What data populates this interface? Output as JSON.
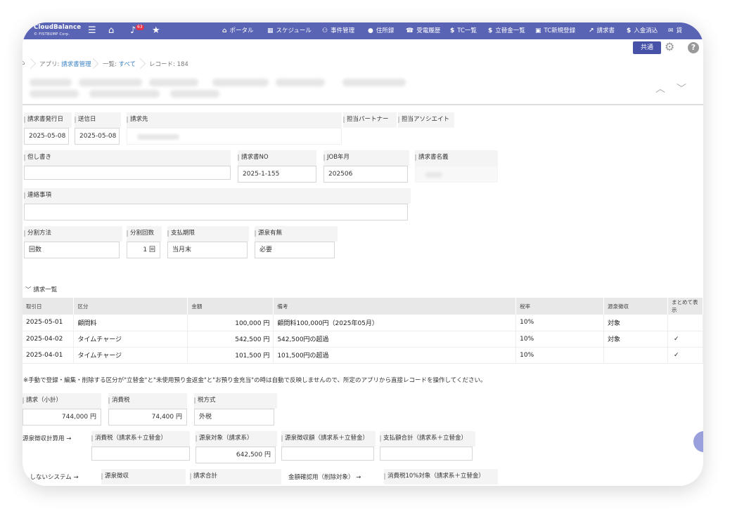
{
  "app": {
    "brand_name": "CloudBalance",
    "brand_sub": "© FISTBUMP Corp.",
    "notification_count": "63"
  },
  "nav": {
    "items": [
      {
        "icon": "⌂",
        "label": "ポータル"
      },
      {
        "icon": "▦",
        "label": "スケジュール"
      },
      {
        "icon": "⚇",
        "label": "事件管理"
      },
      {
        "icon": "●",
        "label": "住所録"
      },
      {
        "icon": "☎",
        "label": "受電履歴"
      },
      {
        "icon": "$",
        "label": "TC一覧"
      },
      {
        "icon": "$",
        "label": "立替金一覧"
      },
      {
        "icon": "▣",
        "label": "TC新規登録"
      },
      {
        "icon": "↗",
        "label": "請求書"
      },
      {
        "icon": "$",
        "label": "入金消込"
      },
      {
        "icon": "✉",
        "label": "貸"
      }
    ]
  },
  "toolbar": {
    "share_label": "共通"
  },
  "breadcrumb": {
    "app_prefix": "アプリ: ",
    "app_name": "請求書管理",
    "list_prefix": "一覧: ",
    "list_name": "すべて",
    "record": "レコード: 184"
  },
  "form": {
    "issue_date_label": "請求書発行日",
    "issue_date": "2025-05-08",
    "send_date_label": "送信日",
    "send_date": "2025-05-08",
    "billing_to_label": "請求先",
    "partner_label": "担当パートナー",
    "associate_label": "担当アソシエイト",
    "memo_label": "但し書き",
    "memo_value": "",
    "invoice_no_label": "請求書NO",
    "invoice_no": "2025-1-155",
    "job_month_label": "JOB年月",
    "job_month": "202506",
    "invoice_name_label": "請求書名義",
    "contact_label": "連絡事項",
    "contact_value": "",
    "split_method_label": "分割方法",
    "split_method": "回数",
    "split_count_label": "分割回数",
    "split_count": "1 回",
    "due_label": "支払期限",
    "due_value": "当月末",
    "withholding_flag_label": "源泉有無",
    "withholding_flag": "必要"
  },
  "billing_list": {
    "title": "請求一覧",
    "columns": [
      "取引日",
      "区分",
      "金額",
      "備考",
      "税率",
      "源泉徴収",
      "まとめて表示"
    ],
    "rows": [
      {
        "date": "2025-05-01",
        "category": "顧問料",
        "amount": "100,000 円",
        "note": "顧問料100,000円（2025年05月）",
        "tax": "10%",
        "withholding": "対象",
        "grouped": ""
      },
      {
        "date": "2025-04-02",
        "category": "タイムチャージ",
        "amount": "542,500 円",
        "note": "542,500円の超過",
        "tax": "10%",
        "withholding": "対象",
        "grouped": "✓"
      },
      {
        "date": "2025-04-01",
        "category": "タイムチャージ",
        "amount": "101,500 円",
        "note": "101,500円の超過",
        "tax": "10%",
        "withholding": "",
        "grouped": "✓"
      }
    ]
  },
  "notice": "※手動で登録・編集・削除する区分が\"立替金\"と\"未使用預り金返金\"と\"お預り金充当\"の時は自動で反映しませんので、所定のアプリから直接レコードを操作してください。",
  "totals": {
    "subtotal_label": "請求（小計）",
    "subtotal": "744,000 円",
    "tax_label": "消費税",
    "tax": "74,400 円",
    "tax_method_label": "税方式",
    "tax_method": "外税"
  },
  "withholding_calc": {
    "row_label": "源泉徴収計算用 →",
    "tax_label": "消費税（請求系＋立替金）",
    "tax_value": "",
    "target_label": "源泉対象（請求系）",
    "target_value": "642,500 円",
    "amount_label": "源泉徴収額（請求系＋立替金）",
    "amount_value": "",
    "total_label": "支払額合計（請求系＋立替金）",
    "total_value": ""
  },
  "bottom_row": {
    "row_label": "…しないシステム →",
    "withholding_label": "源泉徴収",
    "billing_total_label": "請求合計",
    "confirm_label": "金額確認用（削除対象） →",
    "tax10_label": "消費税10%対象（請求系＋立替金）"
  }
}
